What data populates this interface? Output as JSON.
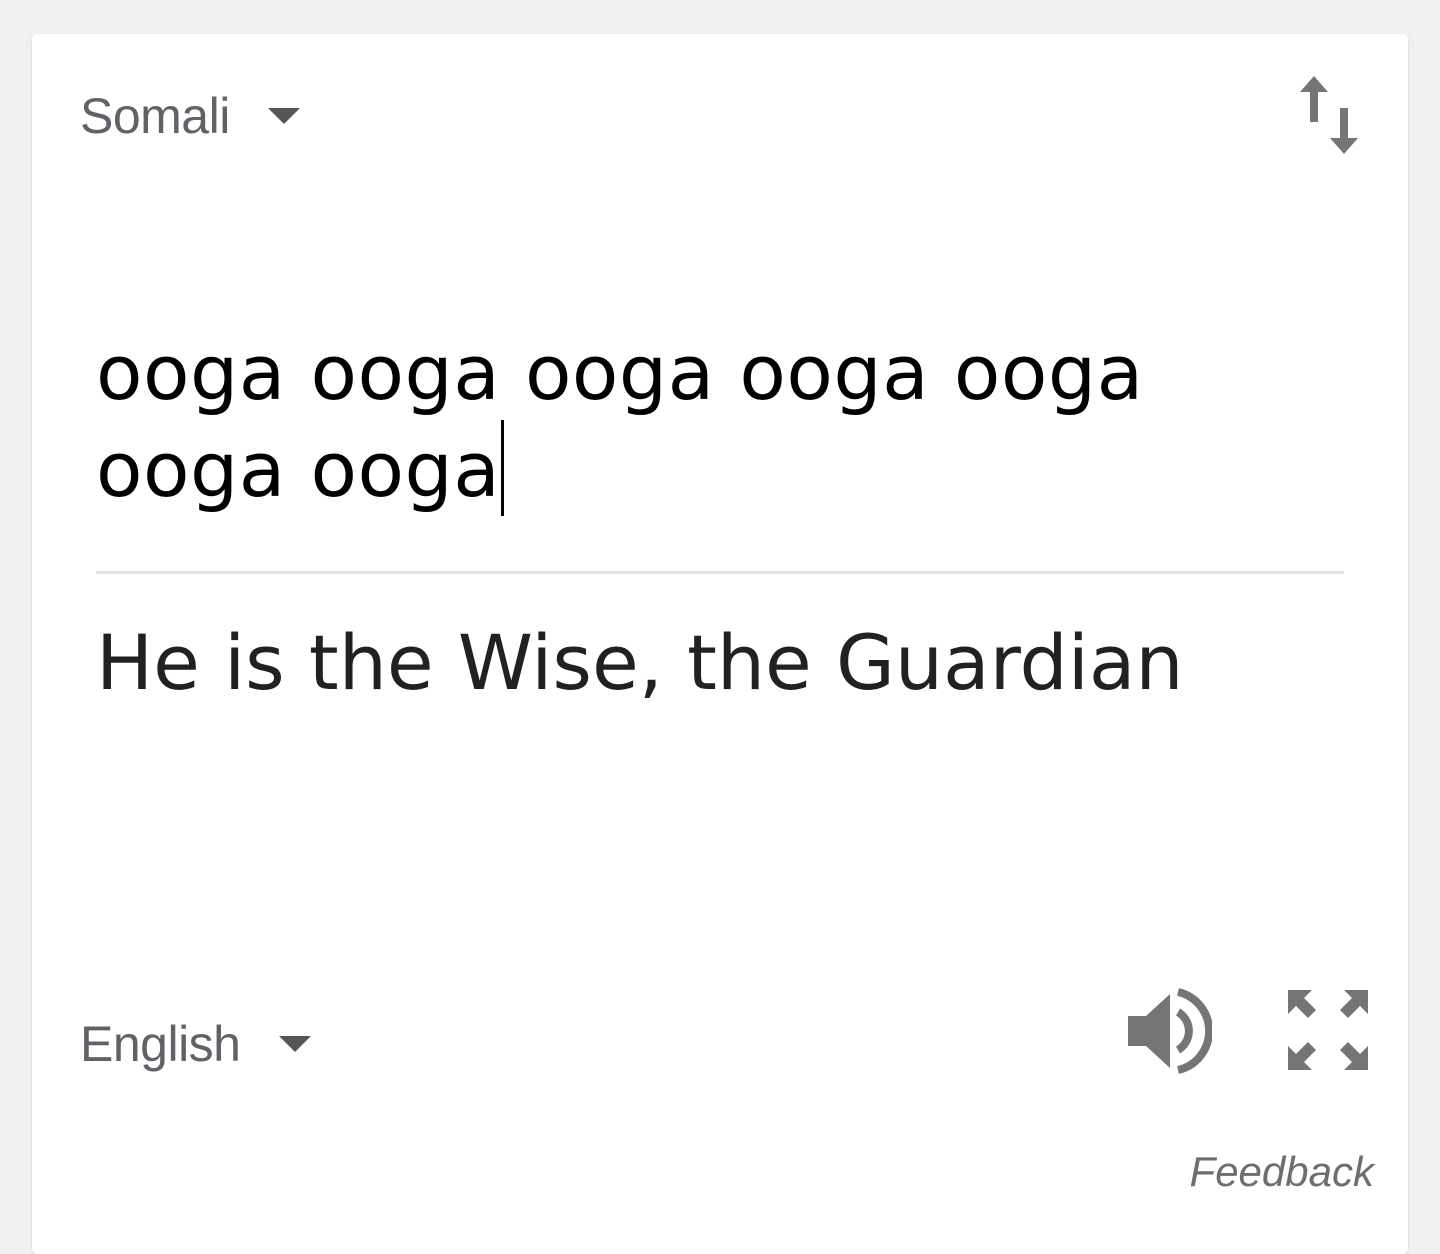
{
  "source": {
    "language": "Somali",
    "input_text": "ooga ooga ooga ooga ooga ooga ooga"
  },
  "target": {
    "language": "English",
    "translation": "He is the Wise, the Guardian"
  },
  "actions": {
    "feedback_label": "Feedback"
  },
  "icons": {
    "swap": "swap-languages-icon",
    "speaker": "speaker-icon",
    "fullscreen": "fullscreen-icon",
    "dropdown": "chevron-down-icon"
  },
  "colors": {
    "page_background": "#f1f1f1",
    "card_background": "#ffffff",
    "icon_gray": "#757575",
    "label_gray": "#5f6368"
  }
}
